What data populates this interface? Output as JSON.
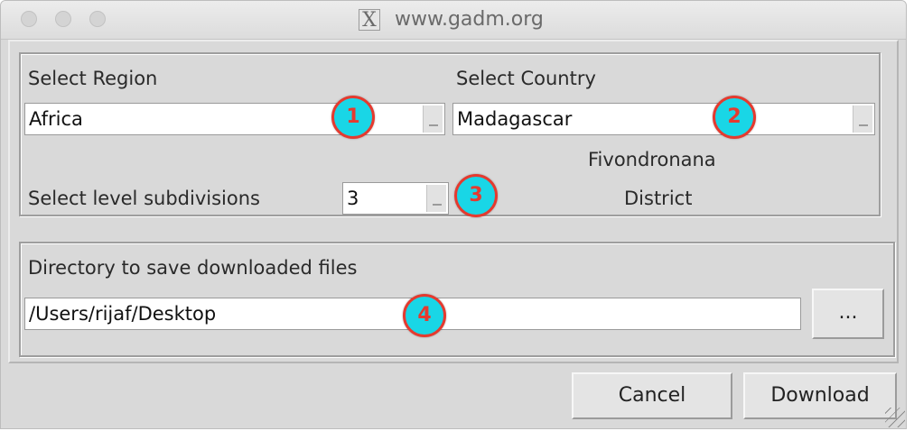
{
  "window": {
    "title": "www.gadm.org",
    "app_icon": "x11-icon"
  },
  "region": {
    "label": "Select Region",
    "value": "Africa"
  },
  "country": {
    "label": "Select Country",
    "value": "Madagascar"
  },
  "level": {
    "label": "Select level subdivisions",
    "value": "3",
    "name_local": "Fivondronana",
    "name_english": "District"
  },
  "directory": {
    "label": "Directory to save downloaded files",
    "value": "/Users/rijaf/Desktop",
    "browse_label": "..."
  },
  "buttons": {
    "cancel": "Cancel",
    "download": "Download"
  },
  "annotations": [
    "1",
    "2",
    "3",
    "4"
  ],
  "colors": {
    "badge_fill": "#19d6e6",
    "badge_text": "#e53a2f"
  }
}
